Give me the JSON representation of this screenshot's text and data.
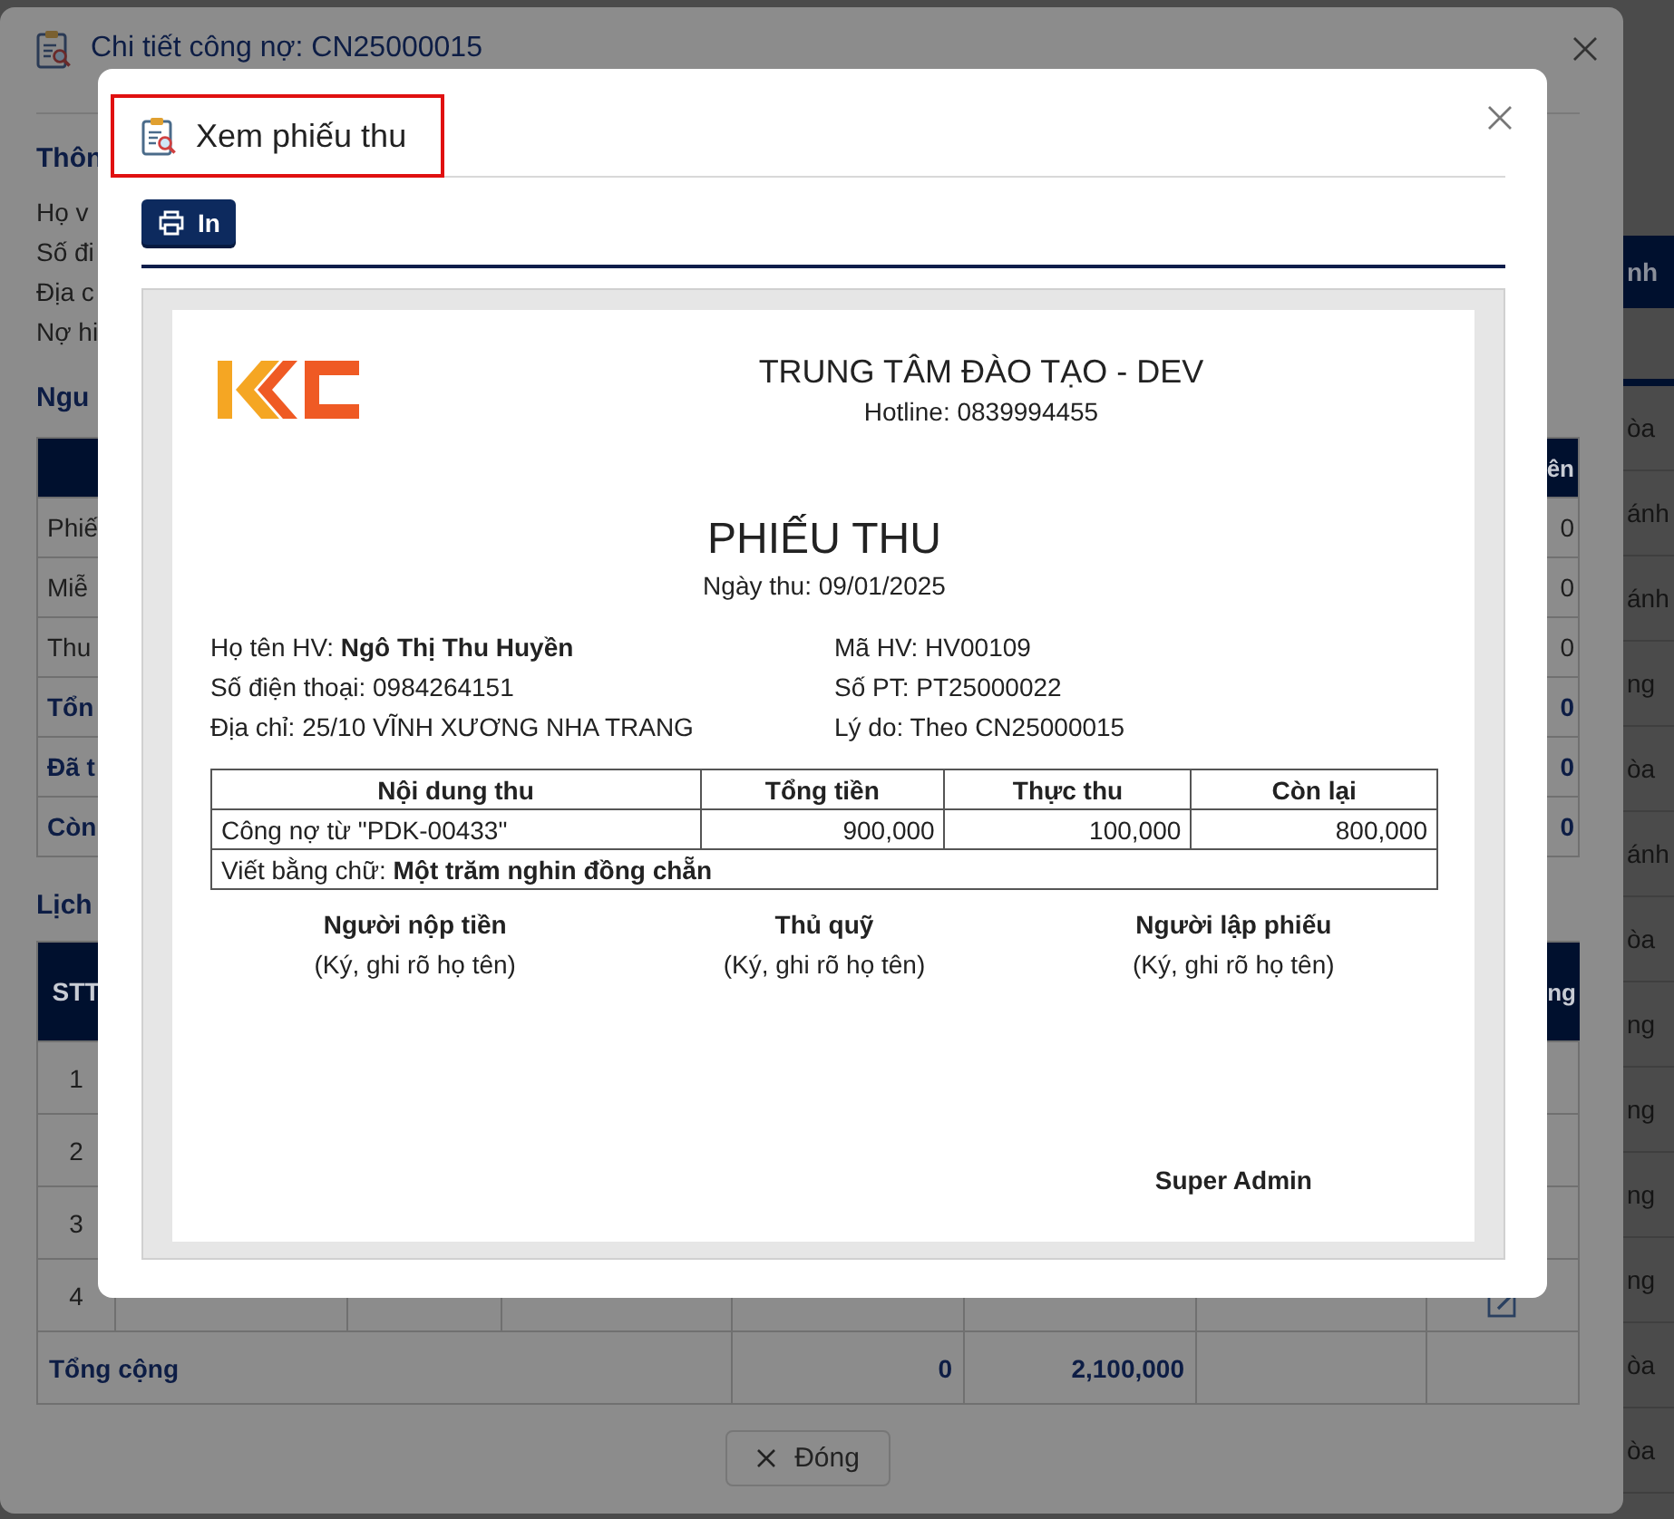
{
  "page": {
    "header_fragment": "nh",
    "row_fragments": [
      "òa",
      "ánh",
      "ánh",
      "ng",
      "òa",
      "ánh",
      "òa",
      "ng",
      "ng",
      "ng",
      "ng",
      "òa",
      "òa"
    ]
  },
  "detail_dialog": {
    "title": "Chi tiết công nợ: CN25000015",
    "section_info": "Thôn",
    "info_lines": [
      "Họ v",
      "Số đi",
      "Địa c",
      "Nợ hi"
    ],
    "section_source": "Ngu",
    "source_table": {
      "header_right": "ên",
      "rows": [
        {
          "kind": "item",
          "label": "Phiế",
          "amount": "0"
        },
        {
          "kind": "item",
          "label": "Miễ",
          "amount": "0"
        },
        {
          "kind": "item",
          "label": "Thu",
          "amount": "0"
        },
        {
          "kind": "summary",
          "label": "Tổn",
          "amount": "0"
        },
        {
          "kind": "summary",
          "label": "Đã t",
          "amount": "0"
        },
        {
          "kind": "summary",
          "label": "Còn",
          "amount": "0"
        }
      ]
    },
    "section_history": "Lịch",
    "history_table": {
      "header_left": "STT",
      "header_right": "ng",
      "rows": [
        "1",
        "2",
        "3",
        "4"
      ],
      "total": {
        "label": "Tổng cộng",
        "column_5": "0",
        "column_6": "2,100,000"
      }
    },
    "close_button": "Đóng"
  },
  "receipt_dialog": {
    "title": "Xem phiếu thu",
    "highlighted": true,
    "print_button": "In",
    "receipt": {
      "center_name": "TRUNG TÂM ĐÀO TẠO - DEV",
      "hotline": "Hotline: 0839994455",
      "heading": "PHIẾU THU",
      "date": "Ngày thu: 09/01/2025",
      "info_left": [
        "Họ tên HV: **Ngô Thị Thu Huyền**",
        "Số điện thoại: 0984264151",
        "Địa chỉ: 25/10 VĨNH XƯƠNG NHA TRANG"
      ],
      "info_right": [
        "Mã HV: HV00109",
        "Số PT: PT25000022",
        "Lý do: Theo CN25000015"
      ],
      "table": {
        "columns": [
          "Nội dung thu",
          "Tổng tiền",
          "Thực thu",
          "Còn lại"
        ],
        "rows": [
          [
            "Công nợ từ \"PDK-00433\"",
            "900,000",
            "100,000",
            "800,000"
          ]
        ],
        "in_words": "Viết bằng chữ: **Một trăm nghin đồng chẵn**"
      },
      "signatures": [
        {
          "role": "Người nộp tiền",
          "hint": "(Ký, ghi rõ họ tên)"
        },
        {
          "role": "Thủ quỹ",
          "hint": "(Ký, ghi rõ họ tên)"
        },
        {
          "role": "Người lập phiếu",
          "hint": "(Ký, ghi rõ họ tên)"
        }
      ],
      "signer": "Super Admin"
    }
  }
}
